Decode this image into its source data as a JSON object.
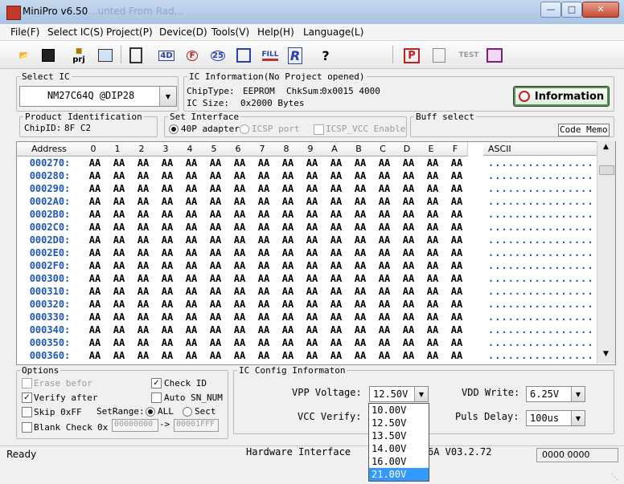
{
  "window": {
    "title": "MiniPro v6.50",
    "ghost_title": "...unted From Rad..."
  },
  "menu": [
    "File(F)",
    "Select IC(S)",
    "Project(P)",
    "Device(D)",
    "Tools(V)",
    "Help(H)",
    "Language(L)"
  ],
  "toolbar": {
    "prj_label": "prj",
    "fill_label": "FILL",
    "test_label": "TEST",
    "r_label": "R",
    "help_label": "?",
    "icon_4d": "4D",
    "icon_25": "25",
    "icon_f": "F",
    "icon_p": "P"
  },
  "select_ic": {
    "legend": "Select IC",
    "value": "NM27C64Q @DIP28"
  },
  "ic_info": {
    "legend": "IC Information(No Project opened)",
    "chip_type_label": "ChipType:",
    "chip_type": "EEPROM",
    "chksum_label": "ChkSum:",
    "chksum": "0x0015 4000",
    "ic_size_label": "IC Size:",
    "ic_size": "0x2000 Bytes",
    "button_label": "Information"
  },
  "product_id": {
    "legend": "Product Identification",
    "chip_id_label": "ChipID:",
    "chip_id": "8F C2"
  },
  "interface": {
    "legend": "Set Interface",
    "opt1": "40P adapter",
    "opt2": "ICSP port",
    "opt3": "ICSP_VCC Enable"
  },
  "buff_select": {
    "legend": "Buff select",
    "value": "Code Memo"
  },
  "hex_grid": {
    "address_header": "Address",
    "columns": [
      "0",
      "1",
      "2",
      "3",
      "4",
      "5",
      "6",
      "7",
      "8",
      "9",
      "A",
      "B",
      "C",
      "D",
      "E",
      "F"
    ],
    "ascii_header": "ASCII",
    "cell_value": "AA",
    "ascii_value": "................",
    "rows": [
      "000270:",
      "000280:",
      "000290:",
      "0002A0:",
      "0002B0:",
      "0002C0:",
      "0002D0:",
      "0002E0:",
      "0002F0:",
      "000300:",
      "000310:",
      "000320:",
      "000330:",
      "000340:",
      "000350:",
      "000360:"
    ]
  },
  "options": {
    "legend": "Options",
    "erase_before": "Erase befor",
    "verify_after": "Verify after",
    "skip_0xff": "Skip 0xFF",
    "blank_check": "Blank Check",
    "check_id": "Check ID",
    "auto_sn": "Auto SN_NUM",
    "set_range_label": "SetRange:",
    "range_all": "ALL",
    "range_sect": "Sect",
    "hex_prefix": "0x",
    "range_start": "00000000",
    "range_arrow": "->",
    "range_end": "00001FFF"
  },
  "ic_config": {
    "legend": "IC Config Informaton",
    "vpp_label": "VPP Voltage:",
    "vpp_value": "12.50V",
    "vcc_label": "VCC Verify:",
    "vdd_label": "VDD Write:",
    "vdd_value": "6.25V",
    "puls_label": "Puls Delay:",
    "puls_value": "100us",
    "vpp_options": [
      "10.00V",
      "12.50V",
      "13.50V",
      "14.00V",
      "16.00V",
      "21.00V"
    ],
    "vpp_highlight_index": 5
  },
  "status": {
    "ready": "Ready",
    "hw_label": "Hardware Interface",
    "hw_version": "6A V03.2.72",
    "counter": "0000 0000"
  }
}
